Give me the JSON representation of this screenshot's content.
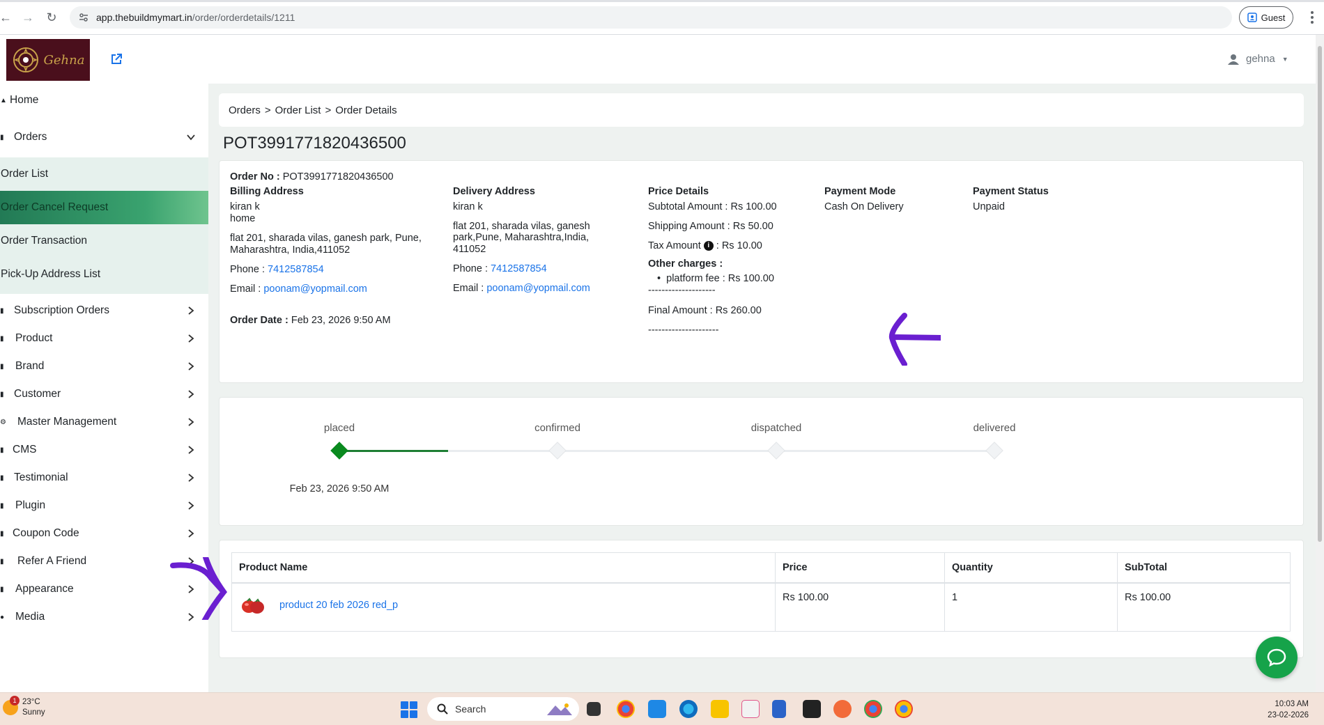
{
  "browser": {
    "url_host": "app.thebuildmymart.in",
    "url_path": "/order/orderdetails/1211",
    "profile_label": "Guest"
  },
  "header": {
    "logo_text": "Gehna",
    "user_name": "gehna"
  },
  "sidebar": {
    "items": [
      {
        "label": "Home"
      },
      {
        "label": "Orders"
      },
      {
        "label": "Subscription Orders"
      },
      {
        "label": "Product"
      },
      {
        "label": "Brand"
      },
      {
        "label": "Customer"
      },
      {
        "label": "Master Management"
      },
      {
        "label": "CMS"
      },
      {
        "label": "Testimonial"
      },
      {
        "label": "Plugin"
      },
      {
        "label": "Coupon Code"
      },
      {
        "label": "Refer A Friend"
      },
      {
        "label": "Appearance"
      },
      {
        "label": "Media"
      }
    ],
    "orders_submenu": [
      {
        "label": "Order List"
      },
      {
        "label": "Order Cancel Request"
      },
      {
        "label": "Order Transaction"
      },
      {
        "label": "Pick-Up Address List"
      }
    ]
  },
  "breadcrumb": [
    "Orders",
    ">",
    "Order List",
    ">",
    "Order Details"
  ],
  "page_title": "POT3991771820436500",
  "order": {
    "order_no_label": "Order No :",
    "order_no": "POT3991771820436500",
    "billing": {
      "heading": "Billing Address",
      "name": "kiran k",
      "type": "home",
      "address_line1": "flat 201, sharada vilas, ganesh park, Pune,",
      "address_line2": "Maharashtra, India,411052",
      "phone_label": "Phone :",
      "phone": "7412587854",
      "email_label": "Email :",
      "email": "poonam@yopmail.com"
    },
    "order_date_label": "Order Date :",
    "order_date": "Feb 23, 2026 9:50 AM",
    "delivery": {
      "heading": "Delivery Address",
      "name": "kiran k",
      "address_line1": "flat 201, sharada vilas, ganesh",
      "address_line2": "park,Pune, Maharashtra,India,",
      "address_line3": "411052",
      "phone_label": "Phone :",
      "phone": "7412587854",
      "email_label": "Email :",
      "email": "poonam@yopmail.com"
    },
    "price": {
      "heading": "Price Details",
      "subtotal": "Subtotal Amount : Rs 100.00",
      "shipping": "Shipping Amount : Rs 50.00",
      "tax_label": "Tax Amount",
      "tax_value": ": Rs  10.00",
      "other_heading": "Other charges :",
      "other_item": "platform fee :  Rs  100.00",
      "divider1": "--------------------",
      "final": "Final Amount : Rs  260.00",
      "divider2": "---------------------"
    },
    "payment_mode_heading": "Payment Mode",
    "payment_mode": "Cash On Delivery",
    "payment_status_heading": "Payment Status",
    "payment_status": "Unpaid"
  },
  "tracker": {
    "steps": [
      {
        "label": "placed",
        "done": true
      },
      {
        "label": "confirmed",
        "done": false
      },
      {
        "label": "dispatched",
        "done": false
      },
      {
        "label": "delivered",
        "done": false
      }
    ],
    "placed_date": "Feb 23, 2026 9:50 AM"
  },
  "products_table": {
    "headers": [
      "Product Name",
      "Price",
      "Quantity",
      "SubTotal"
    ],
    "rows": [
      {
        "name": "product 20 feb 2026 red_p",
        "price": "Rs 100.00",
        "quantity": "1",
        "subtotal": "Rs 100.00"
      }
    ]
  },
  "taskbar": {
    "temperature": "23°C",
    "weather": "Sunny",
    "weather_badge": "1",
    "search_label": "Search",
    "time": "10:03 AM",
    "date": "23-02-2026"
  },
  "colors": {
    "active_menu": "#2e8b60",
    "tracker_done": "#0a8a1f",
    "link": "#1a73e8",
    "annotation": "#6a1fd0",
    "chat": "#16a34a"
  }
}
